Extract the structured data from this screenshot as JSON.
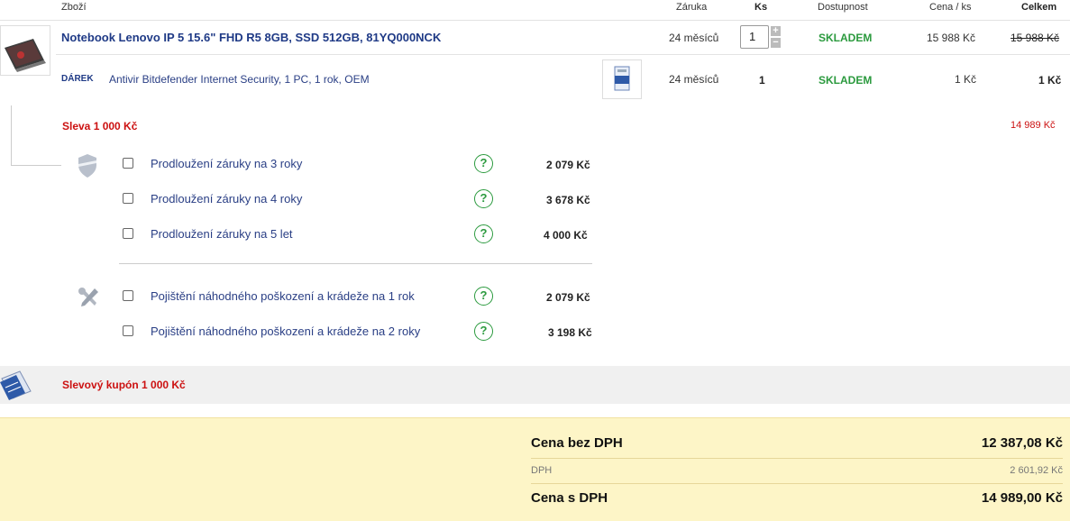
{
  "header": {
    "product": "Zboží",
    "warranty": "Záruka",
    "qty": "Ks",
    "availability": "Dostupnost",
    "unit_price": "Cena / ks",
    "total": "Celkem"
  },
  "product": {
    "title": "Notebook Lenovo IP 5 15.6\" FHD R5 8GB, SSD 512GB, 81YQ000NCK",
    "warranty": "24 měsíců",
    "qty": "1",
    "availability": "SKLADEM",
    "unit_price": "15 988 Kč",
    "total": "15 988 Kč"
  },
  "gift": {
    "badge": "DÁREK",
    "title": "Antivir Bitdefender Internet Security, 1 PC, 1 rok, OEM",
    "warranty": "24 měsíců",
    "qty": "1",
    "availability": "SKLADEM",
    "unit_price": "1 Kč",
    "total": "1 Kč"
  },
  "discount": {
    "label": "Sleva 1 000 Kč",
    "total": "14 989 Kč"
  },
  "warranty_options": [
    {
      "label": "Prodloužení záruky na 3 roky",
      "price": "2 079 Kč",
      "help": "?"
    },
    {
      "label": "Prodloužení záruky na 4 roky",
      "price": "3 678 Kč",
      "help": "?"
    },
    {
      "label": "Prodloužení záruky na 5 let",
      "price": "4 000 Kč",
      "help": "?"
    }
  ],
  "insurance_options": [
    {
      "label": "Pojištění náhodného poškození a krádeže na 1 rok",
      "price": "2 079 Kč",
      "help": "?"
    },
    {
      "label": "Pojištění náhodného poškození a krádeže na 2 roky",
      "price": "3 198 Kč",
      "help": "?"
    }
  ],
  "coupon": {
    "label": "Slevový kupón 1 000 Kč"
  },
  "summary": {
    "no_vat_label": "Cena bez DPH",
    "no_vat_value": "12 387,08 Kč",
    "vat_label": "DPH",
    "vat_value": "2 601,92 Kč",
    "with_vat_label": "Cena s DPH",
    "with_vat_value": "14 989,00 Kč"
  },
  "colors": {
    "accent_blue": "#1f3a86",
    "stock_green": "#2b9a3e",
    "discount_red": "#cc1111",
    "summary_bg": "#fdf5c7"
  }
}
